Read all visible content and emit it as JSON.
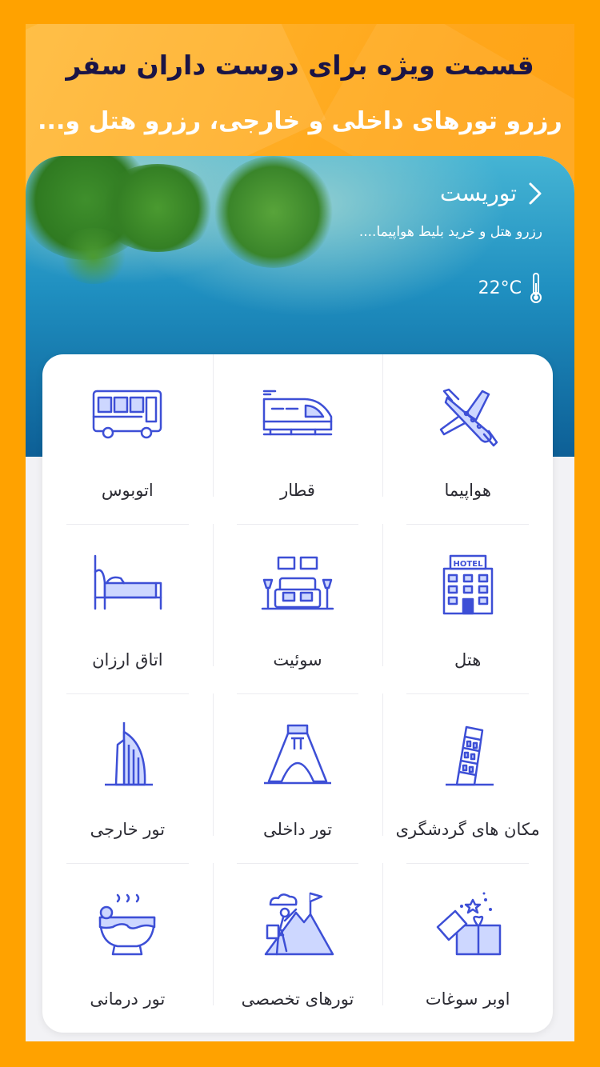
{
  "promo": {
    "title": "قسمت ویژه برای دوست داران سفر",
    "subtitle": "رزرو تورهای داخلی و خارجی، رزرو هتل و..."
  },
  "hero": {
    "city": "توریست",
    "tagline": "رزرو هتل و خرید بلیط هواپیما....",
    "temperature": "22°C",
    "icons": {
      "back": "chevron-right-icon",
      "weather": "thermometer-icon"
    }
  },
  "services": [
    {
      "label": "هواپیما",
      "icon": "airplane-icon"
    },
    {
      "label": "قطار",
      "icon": "train-icon"
    },
    {
      "label": "اتوبوس",
      "icon": "bus-icon"
    },
    {
      "label": "هتل",
      "icon": "hotel-icon"
    },
    {
      "label": "سوئیت",
      "icon": "suite-icon"
    },
    {
      "label": "اتاق ارزان",
      "icon": "bed-icon"
    },
    {
      "label": "مکان های گردشگری",
      "icon": "leaning-tower-icon"
    },
    {
      "label": "تور داخلی",
      "icon": "azadi-tower-icon"
    },
    {
      "label": "تور خارجی",
      "icon": "burj-al-arab-icon"
    },
    {
      "label": "اوبر سوغات",
      "icon": "gift-box-icon"
    },
    {
      "label": "تورهای تخصصی",
      "icon": "mountain-climber-icon"
    },
    {
      "label": "تور درمانی",
      "icon": "hot-spring-icon"
    }
  ],
  "colors": {
    "background": "#ffa200",
    "title": "#1a1446",
    "icon": "#3d4fd6",
    "icon_fill": "#cdd7ff"
  }
}
